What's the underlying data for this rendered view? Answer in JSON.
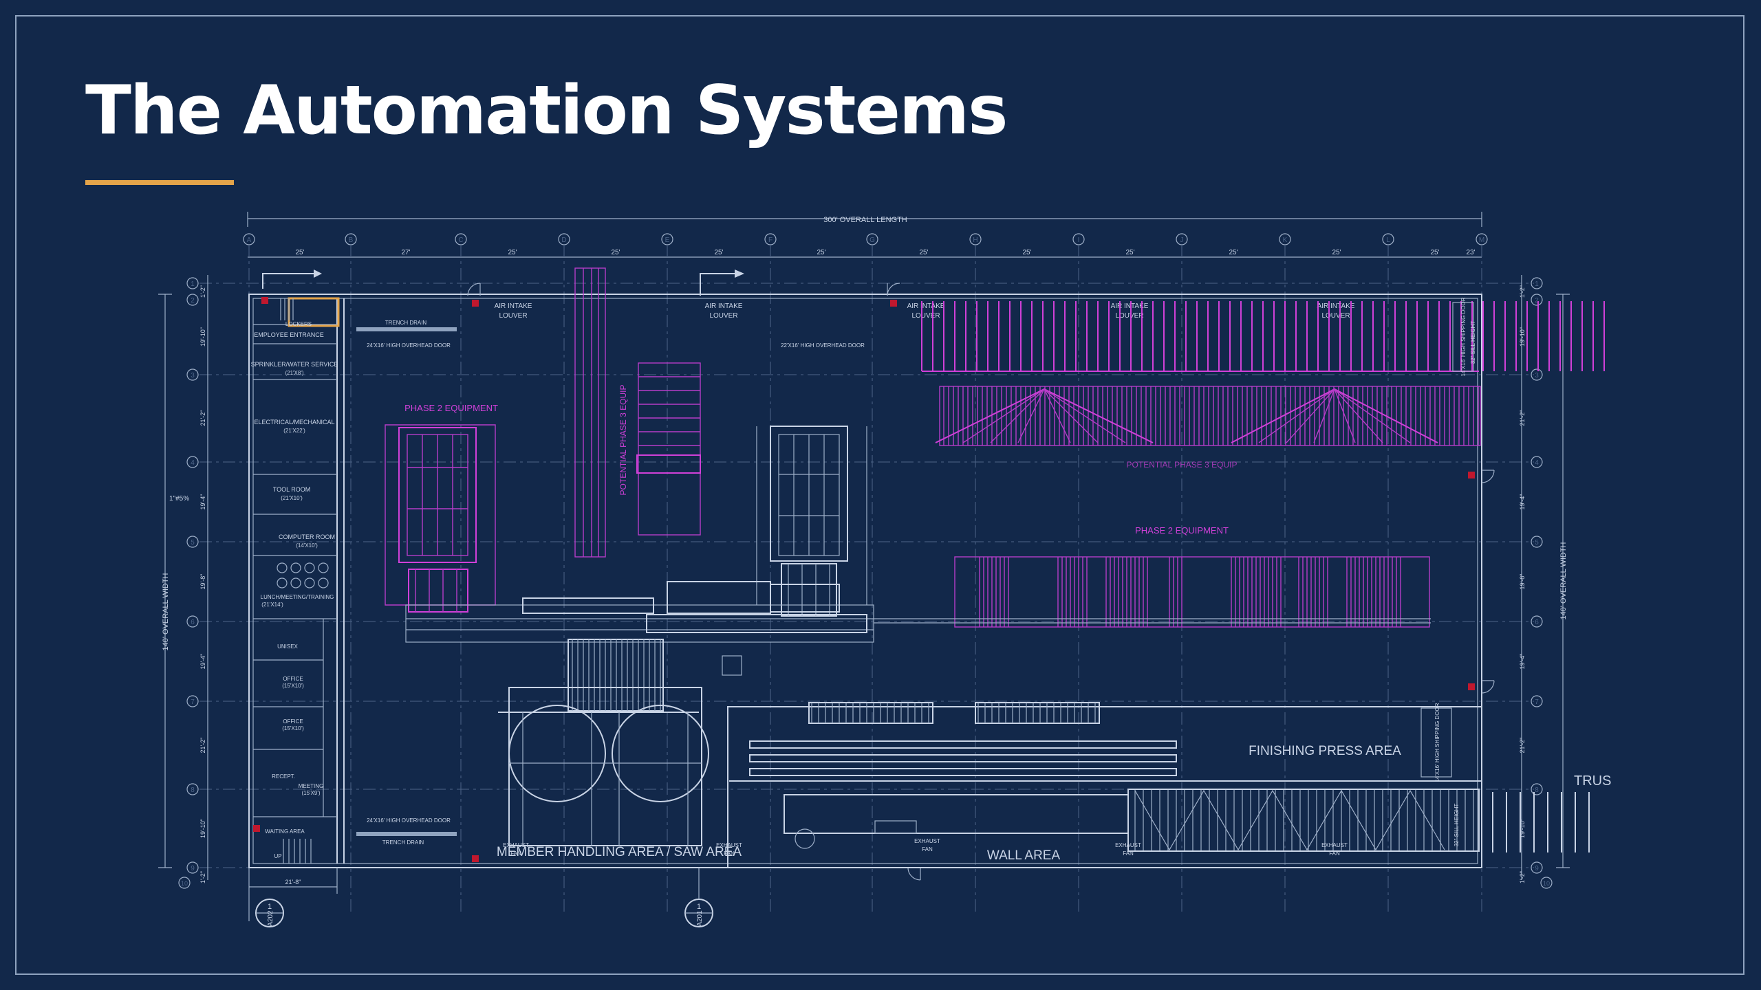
{
  "slide": {
    "title": "The Automation Systems",
    "colors": {
      "background": "#12284a",
      "accent": "#e4a44a",
      "line": "#c9d4e6",
      "magenta": "#d040d8"
    }
  },
  "plan": {
    "overall_length": "300' OVERALL LENGTH",
    "overall_width": "140' OVERALL WIDTH",
    "column_spacings": [
      "25'",
      "27'",
      "25'",
      "25'",
      "25'",
      "25'",
      "25'",
      "25'",
      "25'",
      "25'",
      "25'",
      "25'",
      "23'"
    ],
    "grid_letters": [
      "A",
      "B",
      "C",
      "D",
      "E",
      "F",
      "G",
      "H",
      "I",
      "J",
      "K",
      "L",
      "M"
    ],
    "grid_numbers": [
      "1",
      "2",
      "3",
      "4",
      "5",
      "6",
      "7",
      "8",
      "9",
      "10"
    ],
    "row_dims": [
      "1'-2\"",
      "19'-10\"",
      "21'-2\"",
      "19'-4\"",
      "19'-8\"",
      "19'-4\"",
      "21'-2\"",
      "19'-10\"",
      "1'-2\""
    ],
    "scale_note": "1\"#5%",
    "rooms": [
      "LOCKERS",
      "EMPLOYEE ENTRANCE",
      "SPRINKLER/WATER SERVICE",
      "(21'X8')",
      "ELECTRICAL/MECHANICAL",
      "(21'X22')",
      "TOOL ROOM",
      "(21'X10')",
      "COMPUTER ROOM",
      "(14'X10')",
      "LUNCH/MEETING/TRAINING",
      "(21'X14')",
      "UNISEX",
      "OFFICE",
      "(15'X10')",
      "OFFICE",
      "(15'X10')",
      "RECEPT.",
      "MEETING",
      "(15'X9')",
      "WAITING AREA",
      "UP"
    ],
    "labels": {
      "trench_drain_top": "TRENCH DRAIN",
      "trench_drain_bottom": "TRENCH DRAIN",
      "door_top_left": "24'X16' HIGH OVERHEAD DOOR",
      "door_top_mid": "22'X16' HIGH OVERHEAD DOOR",
      "door_bottom_left": "24'X16' HIGH OVERHEAD DOOR",
      "air_intake": "AIR INTAKE",
      "louver": "LOUVER",
      "phase2_left": "PHASE 2 EQUIPMENT",
      "phase2_right": "PHASE 2 EQUIPMENT",
      "potential_phase3": "POTENTIAL PHASE 3 EQUIP",
      "potential_phase3_right": "POTENTIAL PHASE 3 EQUIP",
      "member_handling": "MEMBER HANDLING AREA / SAW AREA",
      "wall_area": "WALL AREA",
      "finishing_press": "FINISHING PRESS AREA",
      "truss_cut": "TRUS",
      "exhaust_fan": "EXHAUST",
      "fan": "FAN",
      "shipping_door": "14'X16' HIGH SHIPPING DOOR",
      "sill_height": "32\" SILL HEIGHT",
      "section_a": "A202",
      "section_b": "A201",
      "section_num": "1",
      "bottom_dim": "21'-8\""
    }
  }
}
